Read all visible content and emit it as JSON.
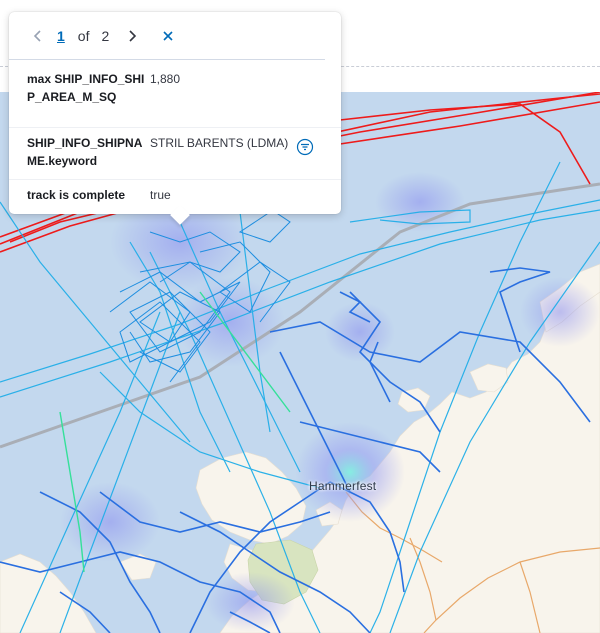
{
  "popup": {
    "pager": {
      "current": "1",
      "of_label": "of",
      "total": "2"
    },
    "rows": [
      {
        "key": "max SHIP_INFO_SHIP_AREA_M_SQ",
        "value": "1,880"
      },
      {
        "key": "SHIP_INFO_SHIPNAME.keyword",
        "value": "STRIL BARENTS (LDMA)"
      },
      {
        "key": "track is complete",
        "value": "true"
      }
    ],
    "icons": {
      "prev": "chevron-left-icon",
      "next": "chevron-right-icon",
      "close": "close-icon",
      "filter": "filter-icon"
    }
  },
  "map": {
    "place_label": "Hammerfest",
    "colors": {
      "sea": "#c3d8ee",
      "land": "#f8f4ec",
      "park": "#d8e4c0",
      "track_blue": "#2a6fe0",
      "track_light": "#22aee8",
      "track_red": "#ee1b1b",
      "track_green": "#35e09a"
    }
  }
}
